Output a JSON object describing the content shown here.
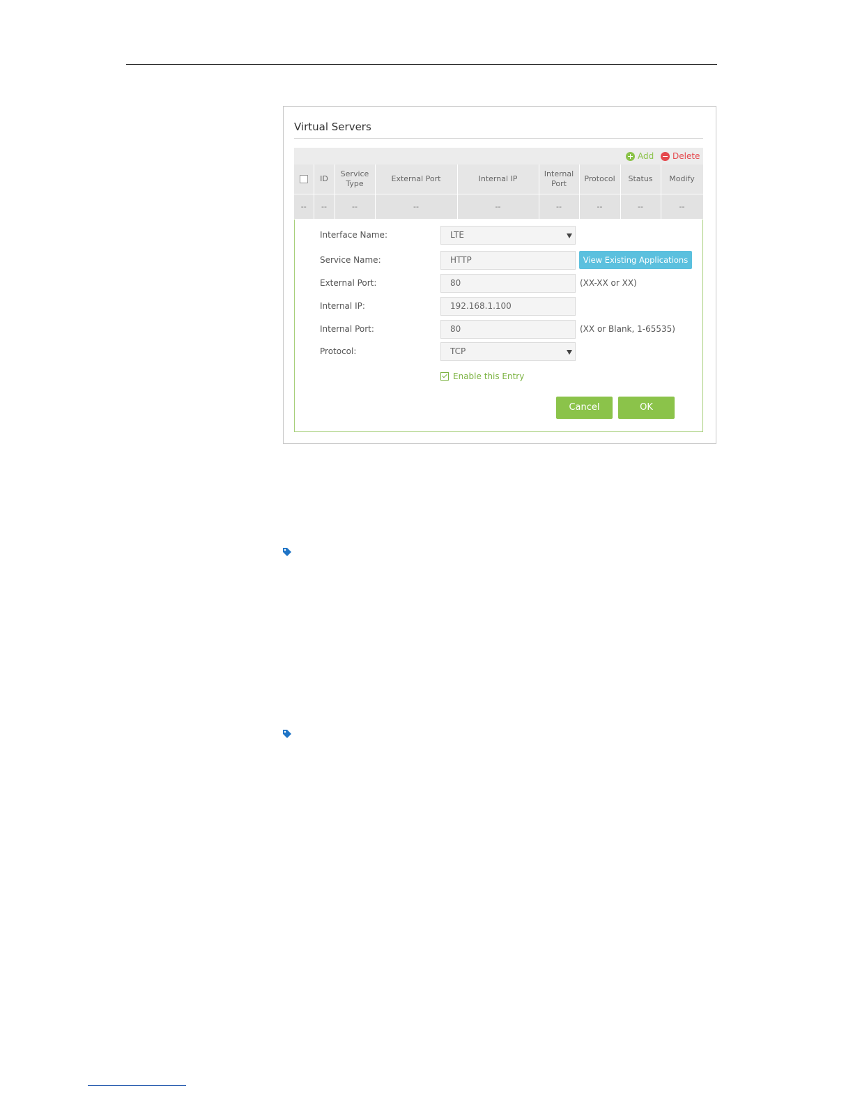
{
  "figure": {
    "title": "Virtual Servers",
    "toolbar": {
      "add_label": "Add",
      "delete_label": "Delete"
    },
    "table": {
      "columns": [
        "ID",
        "Service Type",
        "External Port",
        "Internal IP",
        "Internal Port",
        "Protocol",
        "Status",
        "Modify"
      ],
      "row": [
        "--",
        "--",
        "--",
        "--",
        "--",
        "--",
        "--",
        "--",
        "--"
      ]
    },
    "form": {
      "interface_name": {
        "label": "Interface Name:",
        "value": "LTE"
      },
      "service_name": {
        "label": "Service Name:",
        "value": "HTTP",
        "button": "View Existing Applications"
      },
      "external_port": {
        "label": "External Port:",
        "value": "80",
        "hint": "(XX-XX or XX)"
      },
      "internal_ip": {
        "label": "Internal IP:",
        "value": "192.168.1.100"
      },
      "internal_port": {
        "label": "Internal Port:",
        "value": "80",
        "hint": "(XX or Blank, 1-65535)"
      },
      "protocol": {
        "label": "Protocol:",
        "value": "TCP"
      },
      "enable_label": "Enable this Entry",
      "cancel_label": "Cancel",
      "ok_label": "OK"
    }
  },
  "colors": {
    "accent_green": "#8bc34a",
    "delete_red": "#e5484d",
    "info_blue": "#5bc0de",
    "tag_blue": "#1f74c6"
  },
  "icons": [
    "add-icon",
    "delete-icon",
    "tag-icon"
  ]
}
